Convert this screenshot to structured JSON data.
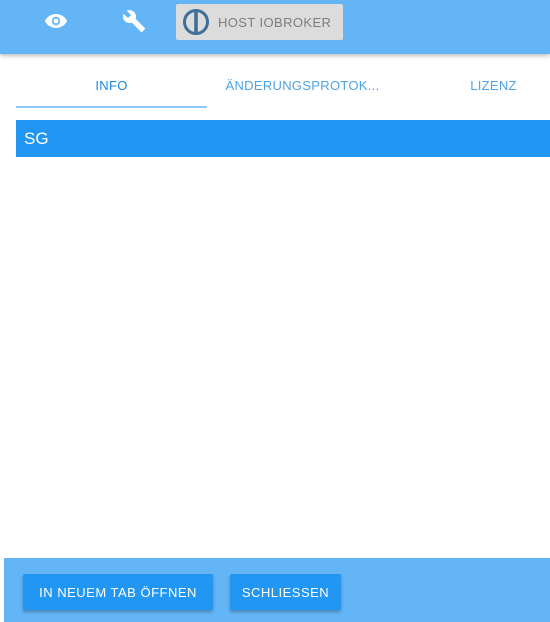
{
  "header": {
    "host_label": "HOST IOBROKER",
    "icons": [
      "eye-icon",
      "wrench-icon",
      "iobroker-logo-icon"
    ],
    "background": "#64b5f6"
  },
  "dialog": {
    "tabs": [
      {
        "label": "INFO",
        "active": true
      },
      {
        "label": "ÄNDERUNGSPROTOK..."
      },
      {
        "label": "LIZENZ"
      }
    ],
    "title": "SG",
    "title_background": "#2196f3"
  },
  "footer": {
    "open_tab_label": "IN NEUEM TAB ÖFFNEN",
    "close_label": "SCHLIESSEN",
    "background": "#64b5f6"
  }
}
